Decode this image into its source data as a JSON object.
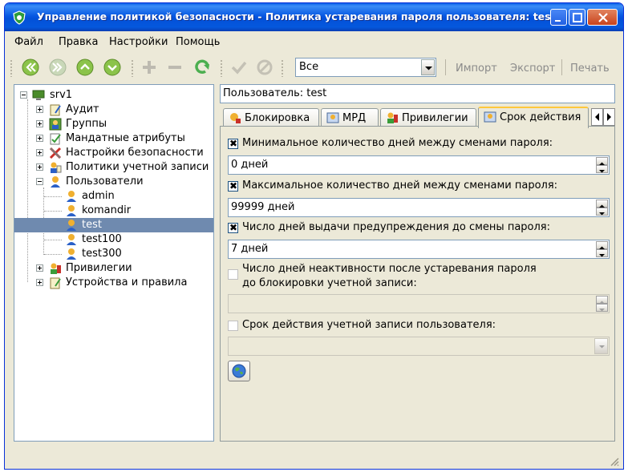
{
  "window": {
    "title": "Управление политикой безопасности - Политика устаревания пароля пользователя: test"
  },
  "menu": [
    "Файл",
    "Правка",
    "Настройки",
    "Помощь"
  ],
  "toolbar": {
    "filter_value": "Все",
    "import_label": "Импорт",
    "export_label": "Экспорт",
    "print_label": "Печать"
  },
  "tree": {
    "root": "srv1",
    "items": [
      {
        "label": "Аудит"
      },
      {
        "label": "Группы"
      },
      {
        "label": "Мандатные атрибуты"
      },
      {
        "label": "Настройки безопасности"
      },
      {
        "label": "Политики учетной записи"
      },
      {
        "label": "Пользователи"
      },
      {
        "label": "admin"
      },
      {
        "label": "komandir"
      },
      {
        "label": "test"
      },
      {
        "label": "test100"
      },
      {
        "label": "test300"
      },
      {
        "label": "Привилегии"
      },
      {
        "label": "Устройства и правила"
      }
    ]
  },
  "user_field": "Пользователь: test",
  "tabs": [
    {
      "label": "Блокировка"
    },
    {
      "label": "МРД"
    },
    {
      "label": "Привилегии"
    },
    {
      "label": "Срок действия"
    }
  ],
  "form": {
    "min_days_label": "Минимальное количество дней между сменами пароля:",
    "min_days_value": "0 дней",
    "max_days_label": "Максимальное количество дней между сменами пароля:",
    "max_days_value": "99999 дней",
    "warn_days_label": "Число дней выдачи предупреждения до смены пароля:",
    "warn_days_value": "7 дней",
    "inactive_label_1": "Число дней неактивности после устаревания пароля",
    "inactive_label_2": "до блокировки учетной записи:",
    "expire_label": "Срок действия учетной записи пользователя:"
  },
  "colors": {
    "title_bar": "#0454dc",
    "selection": "#6f8aaf",
    "tab_highlight": "#ffc83c"
  }
}
